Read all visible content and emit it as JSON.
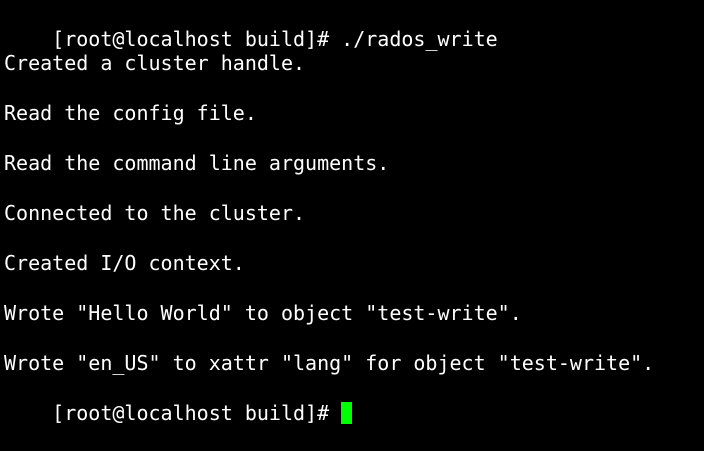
{
  "terminal": {
    "colors": {
      "background": "#000000",
      "text": "#ffffff",
      "cursor": "#00ff00"
    },
    "prompt": "[root@localhost build]#",
    "command": " ./rados_write",
    "output": [
      "Created a cluster handle.",
      "Read the config file.",
      "Read the command line arguments.",
      "Connected to the cluster.",
      "Created I/O context.",
      "Wrote \"Hello World\" to object \"test-write\".",
      "Wrote \"en_US\" to xattr \"lang\" for object \"test-write\"."
    ],
    "final_prompt": "[root@localhost build]#"
  }
}
